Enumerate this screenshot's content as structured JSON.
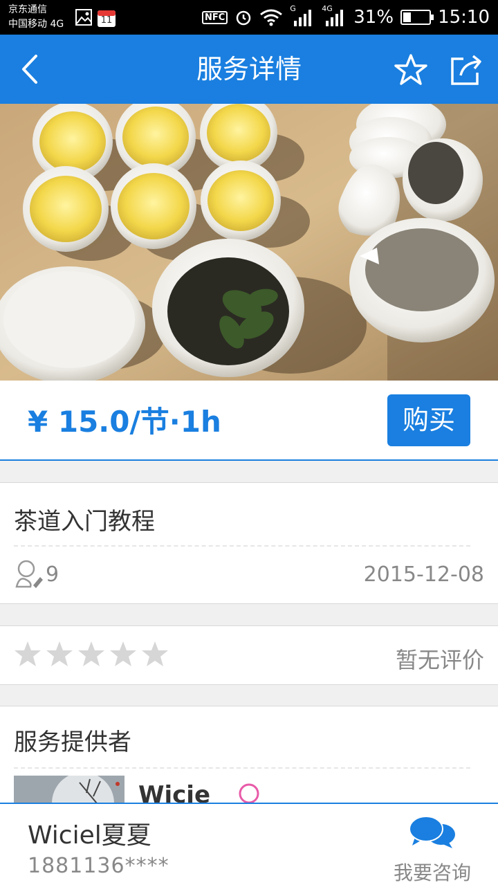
{
  "status_bar": {
    "carrier_1": "京东通信",
    "carrier_2": "中国移动 4G",
    "calendar_day": "11",
    "nfc": "NFC",
    "net_label_1": "G",
    "net_label_2": "4G",
    "battery": "31%",
    "battery_level": 0.31,
    "time": "15:10"
  },
  "header": {
    "title": "服务详情",
    "back_icon": "chevron-left-icon",
    "favorite_icon": "star-outline-icon",
    "share_icon": "share-icon"
  },
  "product": {
    "price": "¥ 15.0/节·1h",
    "buy_label": "购买",
    "title": "茶道入门教程",
    "view_count": "9",
    "date": "2015-12-08"
  },
  "rating": {
    "stars": 0,
    "max_stars": 5,
    "no_review_text": "暂无评价"
  },
  "provider": {
    "heading": "服务提供者",
    "name_partial": "Wicie"
  },
  "bottom_bar": {
    "contact_name": "Wiciel夏夏",
    "contact_phone": "1881136****",
    "consult_label": "我要咨询"
  },
  "colors": {
    "accent": "#1a7fe0",
    "star_empty": "#d6d6d6",
    "gender_female": "#e85aa8"
  }
}
